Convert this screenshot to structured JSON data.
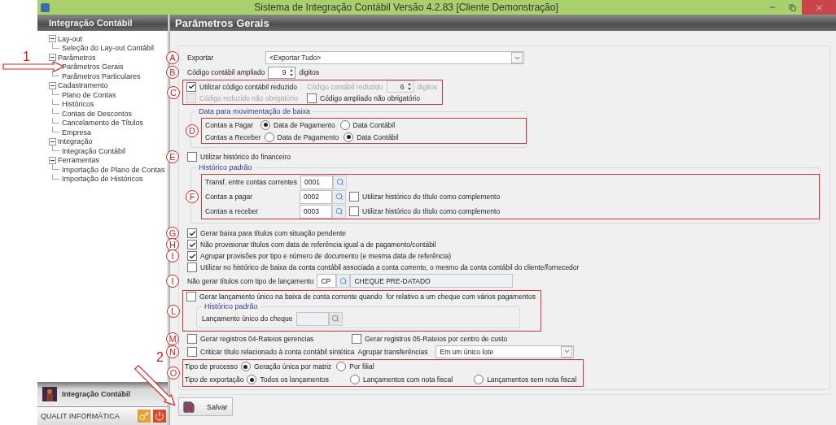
{
  "window": {
    "title": "Sistema de Integração Contábil Versão 4.2.83 [Cliente Demonstração]"
  },
  "sidebar": {
    "title": "Integração Contábil",
    "tree": [
      {
        "label": "Lay-out",
        "expanded": true,
        "children": [
          {
            "label": "Seleção do Lay-out Contábil"
          }
        ]
      },
      {
        "label": "Parâmetros",
        "expanded": true,
        "children": [
          {
            "label": "Parâmetros Gerais"
          },
          {
            "label": "Parâmetros Particulares"
          }
        ]
      },
      {
        "label": "Cadastramento",
        "expanded": true,
        "children": [
          {
            "label": "Plano de Contas"
          },
          {
            "label": "Históricos"
          },
          {
            "label": "Contas de Descontos"
          },
          {
            "label": "Cancelamento de Títulos"
          },
          {
            "label": "Empresa"
          }
        ]
      },
      {
        "label": "Integração",
        "expanded": true,
        "children": [
          {
            "label": "Integração Contábil"
          }
        ]
      },
      {
        "label": "Ferramentas",
        "expanded": true,
        "children": [
          {
            "label": "Importação de Plano de Contas"
          },
          {
            "label": "Importação de Históricos"
          }
        ]
      }
    ],
    "module": "Integração Contábil",
    "company": "QUALIT INFORMÁTICA"
  },
  "page": {
    "title": "Parâmetros Gerais",
    "export": {
      "marker": "A",
      "label": "Exportar",
      "value": "<Exportar Tudo>"
    },
    "extended_code": {
      "marker": "B",
      "label": "Código contábil ampliado",
      "value": "9",
      "unit": "digitos"
    },
    "reduced": {
      "marker": "C",
      "use": {
        "label": "Utilizar código contábil reduzido",
        "checked": true
      },
      "length_label": "Código contábil reduzido",
      "length": "6",
      "unit": "digitos",
      "length_disabled": true,
      "reduced_optional": {
        "label": "Código reduzido não obrigatório",
        "checked": false,
        "disabled": true
      },
      "extended_optional": {
        "label": "Código ampliado não obrigatório",
        "checked": false,
        "disabled": false
      }
    },
    "movement_date": {
      "marker": "D",
      "title": "Data para movimentação de baixa",
      "rows": [
        {
          "label": "Contas a Pagar",
          "options": [
            {
              "label": "Data de Pagamento",
              "selected": true
            },
            {
              "label": "Data Contábil",
              "selected": false
            }
          ]
        },
        {
          "label": "Contas a Receber",
          "options": [
            {
              "label": "Data de Pagamento",
              "selected": false
            },
            {
              "label": "Data Contábil",
              "selected": true
            }
          ]
        }
      ]
    },
    "financial_history": {
      "marker": "E",
      "label": "Utilizar histórico do financeiro",
      "checked": false
    },
    "default_history": {
      "marker": "F",
      "title": "Histórico padrão",
      "rows": [
        {
          "label": "Transf. entre contas correntes",
          "code": "0001"
        },
        {
          "label": "Contas a pagar",
          "code": "0002",
          "complement": {
            "label": "Utilizar histórico do título como complemento",
            "checked": false
          }
        },
        {
          "label": "Contas a receber",
          "code": "0003",
          "complement": {
            "label": "Utilizar histórico do título como complemento",
            "checked": false
          }
        }
      ]
    },
    "options": [
      {
        "marker": "G",
        "label": "Gerar baixa para títulos com situação pendente",
        "checked": true
      },
      {
        "marker": "H",
        "label": "Não provisionar títulos com data de referência igual a de pagamento/contábil",
        "checked": true
      },
      {
        "marker": "I",
        "label": "Agrupar provisões por tipo e número de documento (e mesma data de referência)",
        "checked": true
      },
      {
        "label": "Utilizar no histórico de baixa da conta contábil associada a conta corrente, o mesmo da conta contábil do cliente/fornecedor",
        "checked": false
      }
    ],
    "launch_type": {
      "marker": "I",
      "label": "Não gerar títulos com tipo de lançamento",
      "code": "CP",
      "description": "CHEQUE PRE-DATADO"
    },
    "single_launch": {
      "marker": "L",
      "label": "Gerar lançamento único na baixa de conta corrente quando  for relativo a um cheque com vários pagamentos",
      "checked": false,
      "group_title": "Histórico padrão",
      "field_label": "Lançamento único do cheque",
      "disabled": true
    },
    "apportionment": {
      "marker": "M",
      "items": [
        {
          "label": "Gerar registros 04-Rateios gerencias",
          "checked": false
        },
        {
          "label": "Gerar registros 05-Rateios por centro de custo",
          "checked": false
        }
      ]
    },
    "criticize": {
      "marker": "N",
      "label": "Criticar título relacionado à conta contábil sintética",
      "checked": false,
      "group_label": "Agrupar transferências",
      "group_value": "Em um único lote"
    },
    "process": {
      "marker": "O",
      "rows": [
        {
          "label": "Tipo de processo",
          "options": [
            {
              "label": "Geração única por matriz",
              "selected": true
            },
            {
              "label": "Por filial",
              "selected": false
            }
          ]
        },
        {
          "label": "Tipo de exportação",
          "options": [
            {
              "label": "Todos os lançamentos",
              "selected": true
            },
            {
              "label": "Lançamentos com nota fiscal",
              "selected": false
            },
            {
              "label": "Lançamentos sem nota fiscal",
              "selected": false
            }
          ]
        }
      ]
    },
    "save_button": "Salvar"
  },
  "annotations": [
    {
      "label": "1"
    },
    {
      "label": "2"
    }
  ]
}
